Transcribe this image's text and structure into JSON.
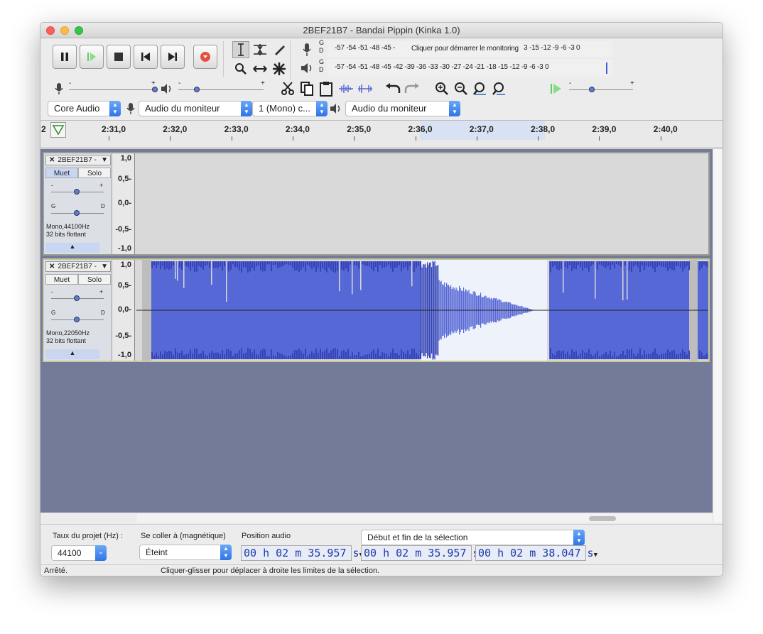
{
  "window": {
    "title": "2BEF21B7 - Bandai Pippin (Kinka 1.0)"
  },
  "meters": {
    "record_scale": "-57 -54 -51 -48 -45 -",
    "record_prompt": "Cliquer pour démarrer le monitoring",
    "record_scale_end": "3 -15 -12 -9 -6 -3 0",
    "play_scale": "-57 -54 -51 -48 -45 -42 -39 -36 -33 -30 -27 -24 -21 -18 -15 -12 -9 -6 -3 0",
    "channel_left": "G",
    "channel_right": "D"
  },
  "devices": {
    "host": "Core Audio",
    "recording_device": "Audio du moniteur",
    "channels": "1 (Mono) c...",
    "playback_device": "Audio du moniteur"
  },
  "ruler": {
    "left_partial": "2",
    "ticks": [
      "2:31,0",
      "2:32,0",
      "2:33,0",
      "2:34,0",
      "2:35,0",
      "2:36,0",
      "2:37,0",
      "2:38,0",
      "2:39,0",
      "2:40,0"
    ]
  },
  "tracks": [
    {
      "name": "2BEF21B7 -",
      "mute": "Muet",
      "solo": "Solo",
      "gain_min": "-",
      "gain_max": "+",
      "pan_left": "G",
      "pan_right": "D",
      "format": "Mono,44100Hz",
      "bits": "32 bits flottant",
      "axis": [
        "1,0",
        "0,5-",
        "0,0-",
        "-0,5-",
        "-1,0"
      ]
    },
    {
      "name": "2BEF21B7 -",
      "mute": "Muet",
      "solo": "Solo",
      "gain_min": "-",
      "gain_max": "+",
      "pan_left": "G",
      "pan_right": "D",
      "format": "Mono,22050Hz",
      "bits": "32 bits flottant",
      "axis": [
        "1,0",
        "0,5-",
        "0,0-",
        "-0,5-",
        "-1,0"
      ]
    }
  ],
  "selection_bar": {
    "rate_label": "Taux du projet (Hz) :",
    "rate_value": "44100",
    "snap_label": "Se coller à (magnétique)",
    "snap_value": "Éteint",
    "position_label": "Position audio",
    "position_value": "00 h 02 m 35.957 s",
    "selection_mode": "Début et fin de la sélection",
    "selection_start": "00 h 02 m 35.957 s",
    "selection_end": "00 h 02 m 38.047 s"
  },
  "status": {
    "state": "Arrêté.",
    "hint": "Cliquer-glisser pour déplacer à droite les limites de la sélection."
  },
  "colors": {
    "waveform": "#5667d6",
    "waveform_dark": "#3443b6",
    "selection": "#eef3fb",
    "background": "#737b98"
  }
}
